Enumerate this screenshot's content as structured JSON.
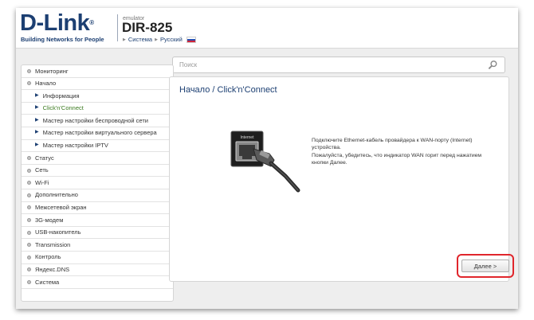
{
  "header": {
    "logo_text": "D-Link",
    "logo_reg": "®",
    "logo_tagline": "Building Networks for People",
    "emulator_label": "emulator",
    "model": "DIR-825",
    "breadcrumb_system": "Система",
    "breadcrumb_language": "Русский"
  },
  "search": {
    "placeholder": "Поиск"
  },
  "sidebar": {
    "items": [
      {
        "label": "Мониторинг"
      },
      {
        "label": "Начало"
      },
      {
        "label": "Информация"
      },
      {
        "label": "Click'n'Connect"
      },
      {
        "label": "Мастер настройки беспроводной сети"
      },
      {
        "label": "Мастер настройки виртуального сервера"
      },
      {
        "label": "Мастер настройки IPTV"
      },
      {
        "label": "Статус"
      },
      {
        "label": "Сеть"
      },
      {
        "label": "Wi-Fi"
      },
      {
        "label": "Дополнительно"
      },
      {
        "label": "Межсетевой экран"
      },
      {
        "label": "3G-модем"
      },
      {
        "label": "USB-накопитель"
      },
      {
        "label": "Transmission"
      },
      {
        "label": "Контроль"
      },
      {
        "label": "Яндекс.DNS"
      },
      {
        "label": "Система"
      }
    ]
  },
  "main": {
    "title": "Начало /  Click'n'Connect",
    "port_label": "Internet",
    "instruction_1": "Подключите Ethernet-кабель провайдера к WAN-порту (Internet) устройства.",
    "instruction_2": "Пожалуйста, убедитесь, что индикатор WAN горит перед нажатием кнопки Далее.",
    "next_button": "Далее >"
  },
  "colors": {
    "brand": "#1c3f72",
    "active_item": "#3a7a1e",
    "highlight": "#e0262c"
  }
}
